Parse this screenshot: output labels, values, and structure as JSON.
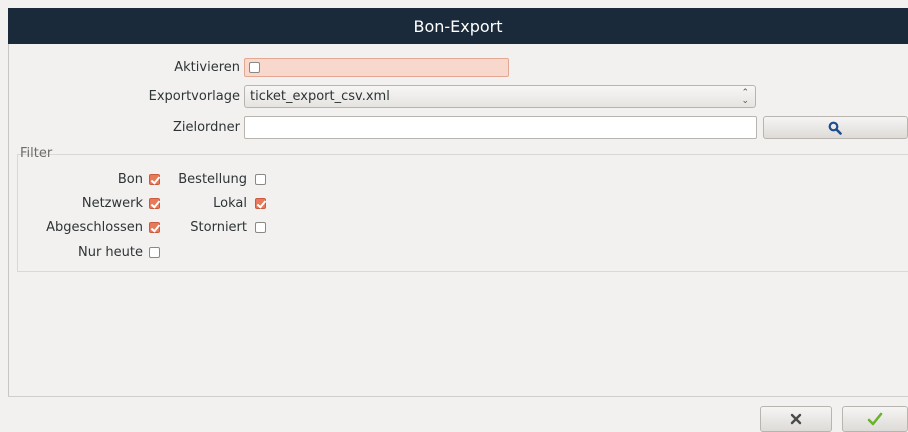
{
  "window": {
    "title": "Bon-Export"
  },
  "form": {
    "activate_label": "Aktivieren",
    "template_label": "Exportvorlage",
    "template_value": "ticket_export_csv.xml",
    "folder_label": "Zielordner",
    "folder_value": ""
  },
  "filter": {
    "legend": "Filter",
    "options": [
      {
        "label": "Bon",
        "checked": true
      },
      {
        "label": "Bestellung",
        "checked": false
      },
      {
        "label": "Netzwerk",
        "checked": true
      },
      {
        "label": "Lokal",
        "checked": true
      },
      {
        "label": "Abgeschlossen",
        "checked": true
      },
      {
        "label": "Storniert",
        "checked": false
      },
      {
        "label": "Nur heute",
        "checked": false
      }
    ]
  },
  "icons": {
    "search": "magnifier-icon",
    "cancel": "x-icon",
    "ok": "checkmark-icon"
  },
  "colors": {
    "titlebar": "#1b2a3a",
    "accent": "#e8795a",
    "ok_icon": "#6bb22e"
  }
}
